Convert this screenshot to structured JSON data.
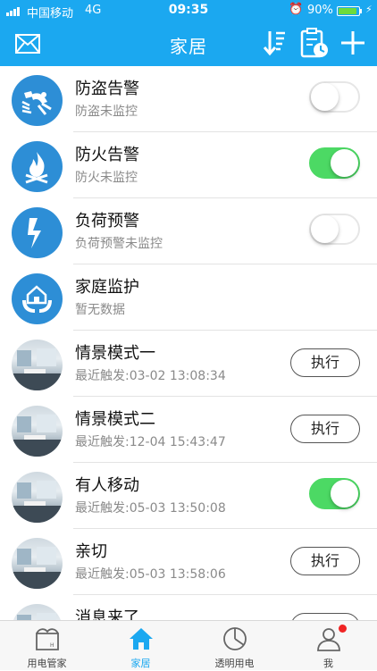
{
  "status_bar": {
    "carrier": "中国移动",
    "network": "4G",
    "time": "09:35",
    "battery": "90%",
    "battery_level": 0.9
  },
  "header": {
    "title": "家居",
    "color": "#1ba8f0"
  },
  "items": [
    {
      "title": "防盗告警",
      "subtitle": "防盗未监控",
      "icon": "burglar-alarm-icon",
      "control": "toggle",
      "on": false
    },
    {
      "title": "防火告警",
      "subtitle": "防火未监控",
      "icon": "fire-alarm-icon",
      "control": "toggle",
      "on": true
    },
    {
      "title": "负荷预警",
      "subtitle": "负荷预警未监控",
      "icon": "lightning-icon",
      "control": "toggle",
      "on": false
    },
    {
      "title": "家庭监护",
      "subtitle": "暂无数据",
      "icon": "home-care-icon",
      "control": "none"
    },
    {
      "title": "情景模式一",
      "subtitle": "最近触发:03-02 13:08:34",
      "icon": "scene-photo",
      "control": "button",
      "button_label": "执行"
    },
    {
      "title": "情景模式二",
      "subtitle": "最近触发:12-04 15:43:47",
      "icon": "scene-photo",
      "control": "button",
      "button_label": "执行"
    },
    {
      "title": "有人移动",
      "subtitle": "最近触发:05-03 13:50:08",
      "icon": "scene-photo",
      "control": "toggle",
      "on": true
    },
    {
      "title": "亲切",
      "subtitle": "最近触发:05-03 13:58:06",
      "icon": "scene-photo",
      "control": "button",
      "button_label": "执行"
    },
    {
      "title": "消息来了",
      "subtitle": "",
      "icon": "scene-photo",
      "control": "button",
      "button_label": ""
    }
  ],
  "tabbar": {
    "tabs": [
      {
        "label": "用电管家",
        "icon": "power-manager-icon"
      },
      {
        "label": "家居",
        "icon": "home-icon",
        "active": true
      },
      {
        "label": "透明用电",
        "icon": "pie-chart-icon"
      },
      {
        "label": "我",
        "icon": "user-icon",
        "badge": true
      }
    ],
    "active_color": "#1ba8f0"
  },
  "colors": {
    "toggle_on": "#4cd964",
    "icon_circle": "#2d8ed6"
  }
}
